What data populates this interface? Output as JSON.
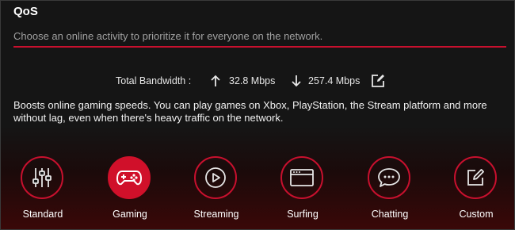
{
  "header": {
    "title": "QoS",
    "subtitle": "Choose an online activity to prioritize it for everyone on the network."
  },
  "bandwidth": {
    "label": "Total Bandwidth :",
    "upload": "32.8 Mbps",
    "download": "257.4 Mbps"
  },
  "description": "Boosts online gaming speeds. You can play games on Xbox, PlayStation, the Stream platform and more without lag, even when there's heavy traffic on the network.",
  "modes": [
    {
      "label": "Standard",
      "icon": "sliders-icon",
      "selected": false
    },
    {
      "label": "Gaming",
      "icon": "gamepad-icon",
      "selected": true
    },
    {
      "label": "Streaming",
      "icon": "play-icon",
      "selected": false
    },
    {
      "label": "Surfing",
      "icon": "browser-icon",
      "selected": false
    },
    {
      "label": "Chatting",
      "icon": "chat-bubble-icon",
      "selected": false
    },
    {
      "label": "Custom",
      "icon": "edit-icon",
      "selected": false
    }
  ],
  "colors": {
    "accent": "#c8102e",
    "background": "#151515"
  }
}
